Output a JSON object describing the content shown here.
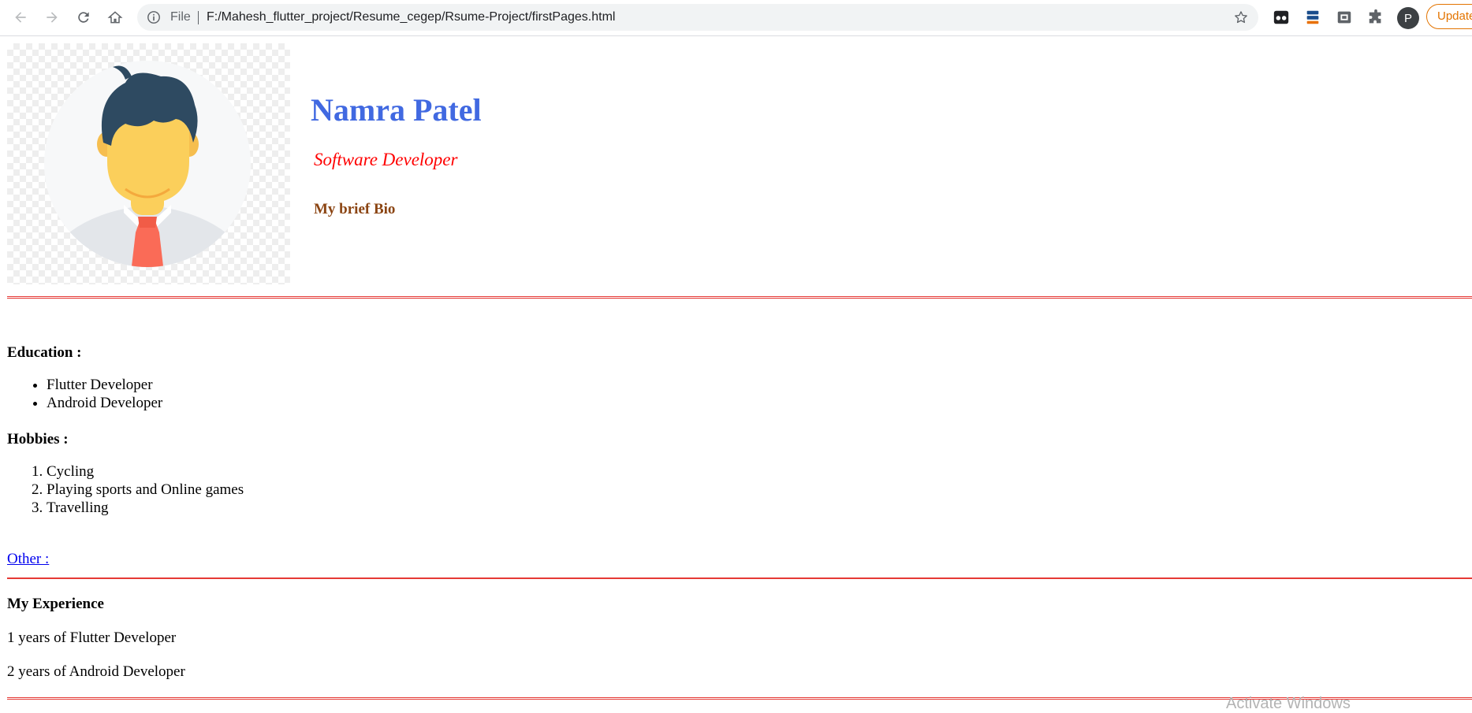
{
  "browser": {
    "scheme_label": "File",
    "url": "F:/Mahesh_flutter_project/Resume_cegep/Rsume-Project/firstPages.html",
    "profile_initial": "P",
    "update_label": "Update"
  },
  "header": {
    "name": "Namra Patel",
    "role": "Software Developer",
    "bio_label": "My brief Bio"
  },
  "education": {
    "heading": "Education :",
    "items": [
      "Flutter Developer",
      "Android Developer"
    ]
  },
  "hobbies": {
    "heading": "Hobbies :",
    "items": [
      "Cycling",
      "Playing sports and Online games",
      "Travelling"
    ]
  },
  "other_link": "Other :",
  "experience": {
    "heading": "My Experience",
    "lines": [
      "1 years of Flutter Developer",
      "2 years of Android Developer"
    ]
  },
  "overlay": {
    "watermark": "Activate Windows"
  },
  "colors": {
    "name": "#4169e1",
    "role": "#ff0000",
    "bio": "#8b4513",
    "rule": "#e53935",
    "link": "#0000ee"
  }
}
